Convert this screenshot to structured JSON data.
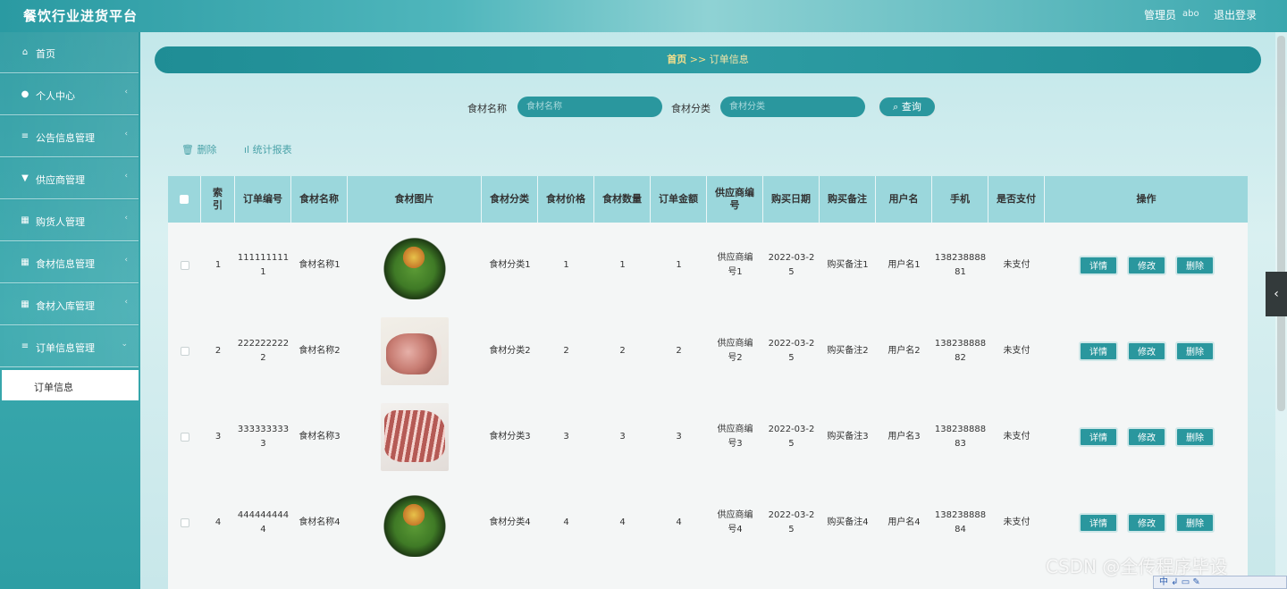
{
  "header": {
    "app_title": "餐饮行业进货平台",
    "admin_label": "管理员",
    "admin_name": "abo",
    "logout_label": "退出登录"
  },
  "sidebar": {
    "items": [
      {
        "label": "首页",
        "icon": "home-icon"
      },
      {
        "label": "个人中心",
        "icon": "user-icon"
      },
      {
        "label": "公告信息管理",
        "icon": "list-icon"
      },
      {
        "label": "供应商管理",
        "icon": "tag-icon"
      },
      {
        "label": "购货人管理",
        "icon": "grid-icon"
      },
      {
        "label": "食材信息管理",
        "icon": "grid-icon"
      },
      {
        "label": "食材入库管理",
        "icon": "grid-icon"
      },
      {
        "label": "订单信息管理",
        "icon": "list-icon"
      }
    ],
    "active_sub": "订单信息"
  },
  "breadcrumb": {
    "home": "首页",
    "separator": ">>",
    "current": "订单信息"
  },
  "search": {
    "name_label": "食材名称",
    "name_placeholder": "食材名称",
    "category_label": "食材分类",
    "category_placeholder": "食材分类",
    "query_label": "查询"
  },
  "toolbar": {
    "delete_label": "删除",
    "stats_label": "统计报表"
  },
  "table": {
    "headers": [
      "索引",
      "订单编号",
      "食材名称",
      "食材图片",
      "食材分类",
      "食材价格",
      "食材数量",
      "订单金额",
      "供应商编号",
      "购买日期",
      "购买备注",
      "用户名",
      "手机",
      "是否支付",
      "操作"
    ],
    "rows": [
      {
        "index": "1",
        "order_no": "1111111111",
        "name": "食材名称1",
        "image": "salad",
        "category": "食材分类1",
        "price": "1",
        "qty": "1",
        "amount": "1",
        "supplier": "供应商编号1",
        "date": "2022-03-25",
        "note": "购买备注1",
        "user": "用户名1",
        "phone": "13823888881",
        "paid": "未支付"
      },
      {
        "index": "2",
        "order_no": "2222222222",
        "name": "食材名称2",
        "image": "meat1",
        "category": "食材分类2",
        "price": "2",
        "qty": "2",
        "amount": "2",
        "supplier": "供应商编号2",
        "date": "2022-03-25",
        "note": "购买备注2",
        "user": "用户名2",
        "phone": "13823888882",
        "paid": "未支付"
      },
      {
        "index": "3",
        "order_no": "3333333333",
        "name": "食材名称3",
        "image": "meat2",
        "category": "食材分类3",
        "price": "3",
        "qty": "3",
        "amount": "3",
        "supplier": "供应商编号3",
        "date": "2022-03-25",
        "note": "购买备注3",
        "user": "用户名3",
        "phone": "13823888883",
        "paid": "未支付"
      },
      {
        "index": "4",
        "order_no": "4444444444",
        "name": "食材名称4",
        "image": "salad",
        "category": "食材分类4",
        "price": "4",
        "qty": "4",
        "amount": "4",
        "supplier": "供应商编号4",
        "date": "2022-03-25",
        "note": "购买备注4",
        "user": "用户名4",
        "phone": "13823888884",
        "paid": "未支付"
      }
    ],
    "actions": {
      "detail": "详情",
      "edit": "修改",
      "delete": "删除"
    }
  },
  "watermark": "CSDN @全传程序毕设",
  "ime_text": "中 ↲ ▭ ✎"
}
